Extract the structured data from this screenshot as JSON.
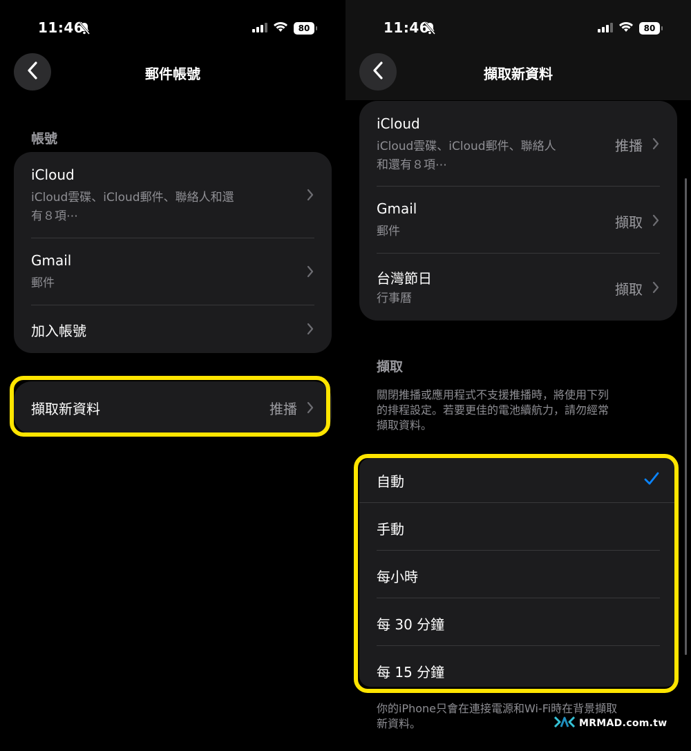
{
  "status_bar": {
    "time": "11:46",
    "battery": "80"
  },
  "left": {
    "nav_title": "郵件帳號",
    "accounts_section_label": "帳號",
    "accounts": [
      {
        "title": "iCloud",
        "subtitle_line1": "iCloud雲碟、iCloud郵件、聯絡人和還",
        "subtitle_line2": "有８項⋯"
      },
      {
        "title": "Gmail",
        "subtitle": "郵件"
      },
      {
        "title": "加入帳號"
      }
    ],
    "fetch_row": {
      "title": "擷取新資料",
      "value": "推播"
    }
  },
  "right": {
    "nav_title": "擷取新資料",
    "accounts": [
      {
        "title": "iCloud",
        "subtitle_line1": "iCloud雲碟、iCloud郵件、聯絡人",
        "subtitle_line2": "和還有８項⋯",
        "value": "推播"
      },
      {
        "title": "Gmail",
        "subtitle": "郵件",
        "value": "擷取"
      },
      {
        "title": "台灣節日",
        "subtitle": "行事曆",
        "value": "擷取"
      }
    ],
    "fetch_section_label": "擷取",
    "fetch_description_lines": [
      "關閉推播或應用程式不支援推播時，將使用下列",
      "的排程設定。若要更佳的電池續航力，請勿經常",
      "擷取資料。"
    ],
    "options": [
      {
        "label": "自動",
        "selected": true
      },
      {
        "label": "手動",
        "selected": false
      },
      {
        "label": "每小時",
        "selected": false
      },
      {
        "label": "每 30 分鐘",
        "selected": false
      },
      {
        "label": "每 15 分鐘",
        "selected": false
      }
    ],
    "footnote_lines": [
      "你的iPhone只會在連接電源和Wi-Fi時在背景擷取",
      "新資料。"
    ]
  },
  "watermark": {
    "text": "MRMAD.com.tw"
  },
  "colors": {
    "highlight": "#ffe500",
    "check": "#0a84ff",
    "group_bg": "#1c1c1e"
  }
}
